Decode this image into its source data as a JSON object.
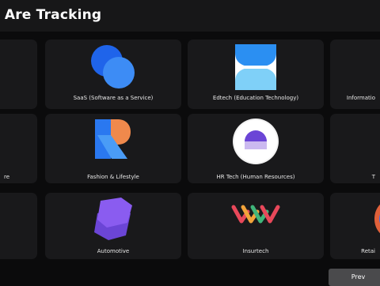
{
  "header": {
    "title": "e Are Tracking"
  },
  "categories": [
    {
      "label": ""
    },
    {
      "label": "SaaS (Software as a Service)",
      "icon": "overlapping-circles-icon"
    },
    {
      "label": "Edtech (Education Technology)",
      "icon": "hourglass-icon"
    },
    {
      "label": "Informatio",
      "icon": ""
    },
    {
      "label": "re"
    },
    {
      "label": "Fashion & Lifestyle",
      "icon": "letter-r-icon"
    },
    {
      "label": "HR Tech (Human Resources)",
      "icon": "purple-dome-icon"
    },
    {
      "label": "T"
    },
    {
      "label": ""
    },
    {
      "label": "Automotive",
      "icon": "stacked-diamonds-icon"
    },
    {
      "label": "Insurtech",
      "icon": "chevrons-icon"
    },
    {
      "label": "Retai"
    }
  ],
  "pagination": {
    "prev_label": "Prev"
  },
  "colors": {
    "blue": "#2b6ef2",
    "purple": "#6b45d6",
    "orange": "#f0894c"
  }
}
